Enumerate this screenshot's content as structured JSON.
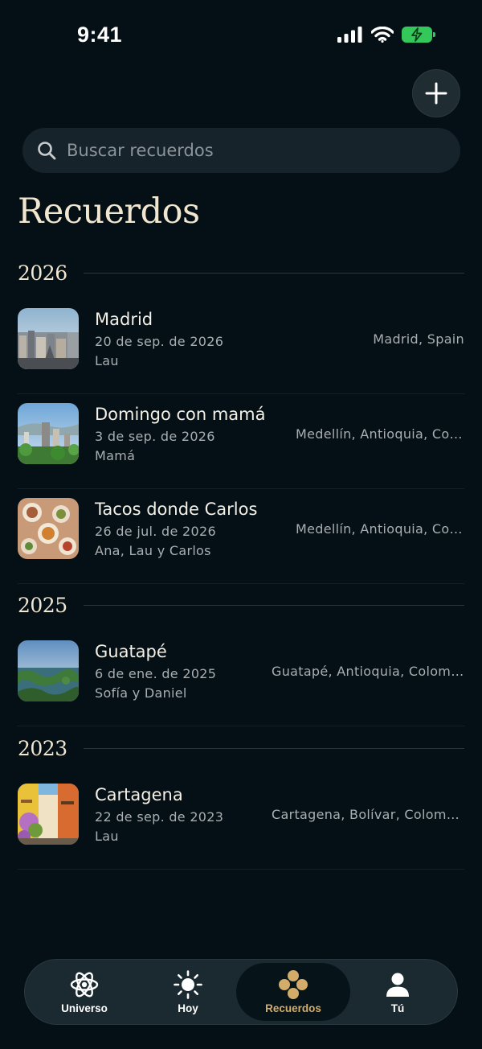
{
  "status_bar": {
    "time": "9:41",
    "icons": [
      "signal-icon",
      "wifi-icon",
      "battery-charging-icon"
    ],
    "battery_color": "#34c759"
  },
  "header": {
    "add_icon": "plus-icon"
  },
  "search": {
    "placeholder": "Buscar recuerdos",
    "value": "",
    "icon": "search-icon"
  },
  "page": {
    "title": "Recuerdos"
  },
  "sections": [
    {
      "year": "2026",
      "items": [
        {
          "title": "Madrid",
          "date": "20 de sep. de 2026",
          "people": "Lau",
          "place": "Madrid, Spain"
        },
        {
          "title": "Domingo con mamá",
          "date": "3 de sep. de 2026",
          "people": "Mamá",
          "place": "Medellín, Antioquia, Colombia"
        },
        {
          "title": "Tacos donde Carlos",
          "date": "26 de jul. de 2026",
          "people": "Ana, Lau y Carlos",
          "place": "Medellín, Antioquia, Colombia"
        }
      ]
    },
    {
      "year": "2025",
      "items": [
        {
          "title": "Guatapé",
          "date": "6 de ene. de 2025",
          "people": "Sofía y Daniel",
          "place": "Guatapé, Antioquia, Colombia"
        }
      ]
    },
    {
      "year": "2023",
      "items": [
        {
          "title": "Cartagena",
          "date": "22 de sep. de 2023",
          "people": "Lau",
          "place": "Cartagena, Bolívar, Colombia"
        }
      ]
    }
  ],
  "tab_bar": {
    "active": "Recuerdos",
    "accent_color": "#d4ac69",
    "tabs": [
      {
        "label": "Universo",
        "icon": "atom-icon"
      },
      {
        "label": "Hoy",
        "icon": "sun-icon"
      },
      {
        "label": "Recuerdos",
        "icon": "circles-icon"
      },
      {
        "label": "Tú",
        "icon": "person-icon"
      }
    ]
  }
}
